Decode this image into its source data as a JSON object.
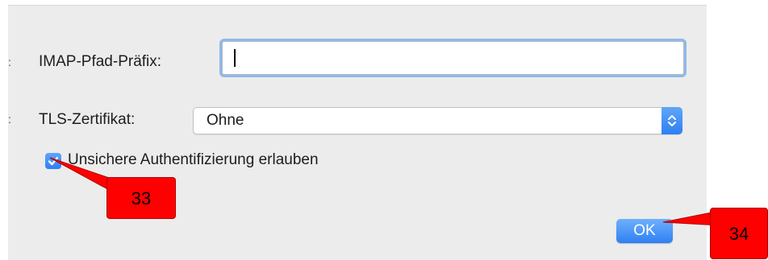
{
  "dialog": {
    "imap_prefix_label": "IMAP-Pfad-Präfix:",
    "imap_prefix_value": "",
    "tls_label": "TLS-Zertifikat:",
    "tls_selected": "Ohne",
    "insecure_auth_label": "Unsichere Authentifizierung erlauben",
    "insecure_auth_checked": true,
    "ok_label": "OK"
  },
  "annotations": {
    "callout_checkbox": "33",
    "callout_ok": "34"
  },
  "colors": {
    "accent_blue": "#2f7ff3",
    "callout_red": "#ff0000",
    "dialog_bg": "#ececec"
  },
  "icons": [
    "updown-arrows-icon",
    "checkmark-icon"
  ]
}
